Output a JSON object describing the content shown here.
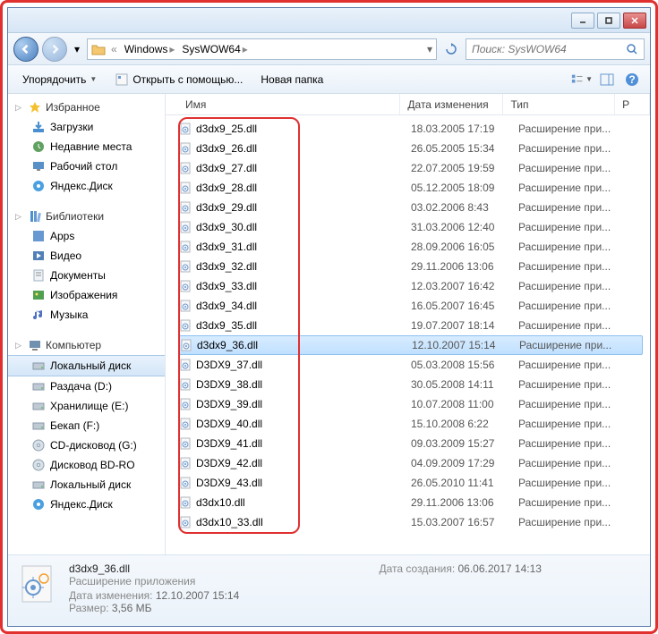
{
  "breadcrumb": {
    "parts": [
      "Windows",
      "SysWOW64"
    ]
  },
  "search": {
    "placeholder": "Поиск: SysWOW64"
  },
  "toolbar": {
    "organize": "Упорядочить",
    "open_with": "Открыть с помощью...",
    "new_folder": "Новая папка"
  },
  "columns": {
    "name": "Имя",
    "date": "Дата изменения",
    "type": "Тип",
    "size": "Р"
  },
  "sidebar": {
    "favorites": {
      "label": "Избранное",
      "items": [
        {
          "label": "Загрузки",
          "ico": "dl"
        },
        {
          "label": "Недавние места",
          "ico": "clock"
        },
        {
          "label": "Рабочий стол",
          "ico": "desk"
        },
        {
          "label": "Яндекс.Диск",
          "ico": "disk"
        }
      ]
    },
    "libraries": {
      "label": "Библиотеки",
      "items": [
        {
          "label": "Apps",
          "ico": "app"
        },
        {
          "label": "Видео",
          "ico": "vid"
        },
        {
          "label": "Документы",
          "ico": "doc"
        },
        {
          "label": "Изображения",
          "ico": "img"
        },
        {
          "label": "Музыка",
          "ico": "mus"
        }
      ]
    },
    "computer": {
      "label": "Компьютер",
      "items": [
        {
          "label": "Локальный диск",
          "ico": "drive",
          "sel": true
        },
        {
          "label": "Раздача (D:)",
          "ico": "drive"
        },
        {
          "label": "Хранилище (E:)",
          "ico": "drive"
        },
        {
          "label": "Бекап (F:)",
          "ico": "drive"
        },
        {
          "label": "CD-дисковод (G:)",
          "ico": "cd"
        },
        {
          "label": "Дисковод BD-RO",
          "ico": "cd"
        },
        {
          "label": "Локальный диск",
          "ico": "drive"
        },
        {
          "label": "Яндекс.Диск",
          "ico": "disk"
        }
      ]
    }
  },
  "type_label": "Расширение при...",
  "files": [
    {
      "name": "d3dx9_25.dll",
      "date": "18.03.2005 17:19"
    },
    {
      "name": "d3dx9_26.dll",
      "date": "26.05.2005 15:34"
    },
    {
      "name": "d3dx9_27.dll",
      "date": "22.07.2005 19:59"
    },
    {
      "name": "d3dx9_28.dll",
      "date": "05.12.2005 18:09"
    },
    {
      "name": "d3dx9_29.dll",
      "date": "03.02.2006 8:43"
    },
    {
      "name": "d3dx9_30.dll",
      "date": "31.03.2006 12:40"
    },
    {
      "name": "d3dx9_31.dll",
      "date": "28.09.2006 16:05"
    },
    {
      "name": "d3dx9_32.dll",
      "date": "29.11.2006 13:06"
    },
    {
      "name": "d3dx9_33.dll",
      "date": "12.03.2007 16:42"
    },
    {
      "name": "d3dx9_34.dll",
      "date": "16.05.2007 16:45"
    },
    {
      "name": "d3dx9_35.dll",
      "date": "19.07.2007 18:14"
    },
    {
      "name": "d3dx9_36.dll",
      "date": "12.10.2007 15:14",
      "sel": true
    },
    {
      "name": "D3DX9_37.dll",
      "date": "05.03.2008 15:56"
    },
    {
      "name": "D3DX9_38.dll",
      "date": "30.05.2008 14:11"
    },
    {
      "name": "D3DX9_39.dll",
      "date": "10.07.2008 11:00"
    },
    {
      "name": "D3DX9_40.dll",
      "date": "15.10.2008 6:22"
    },
    {
      "name": "D3DX9_41.dll",
      "date": "09.03.2009 15:27"
    },
    {
      "name": "D3DX9_42.dll",
      "date": "04.09.2009 17:29"
    },
    {
      "name": "D3DX9_43.dll",
      "date": "26.05.2010 11:41"
    },
    {
      "name": "d3dx10.dll",
      "date": "29.11.2006 13:06"
    },
    {
      "name": "d3dx10_33.dll",
      "date": "15.03.2007 16:57"
    }
  ],
  "details": {
    "name": "d3dx9_36.dll",
    "type": "Расширение приложения",
    "mod_label": "Дата изменения:",
    "mod": "12.10.2007 15:14",
    "size_label": "Размер:",
    "size": "3,56 МБ",
    "created_label": "Дата создания:",
    "created": "06.06.2017 14:13"
  }
}
